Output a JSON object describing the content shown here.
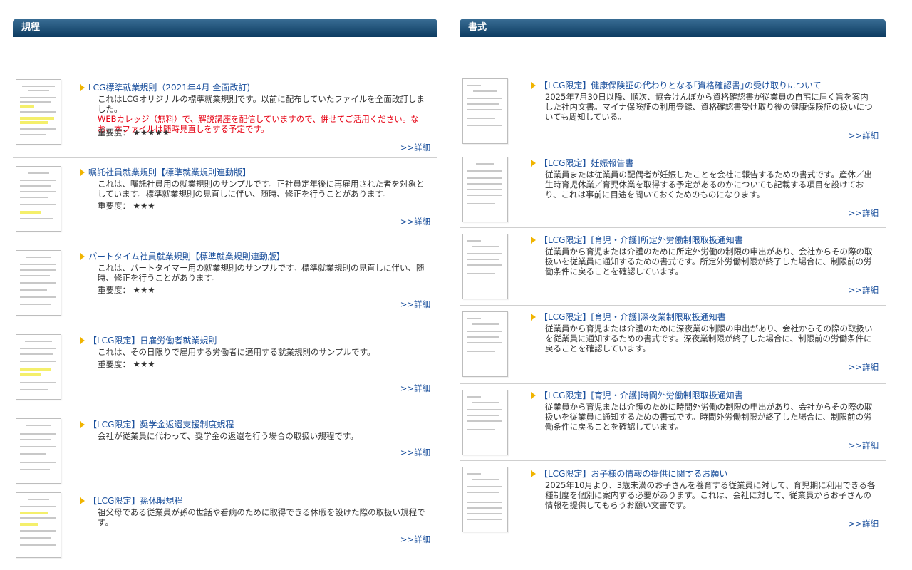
{
  "left": {
    "header": "規程",
    "importance_label": "重要度：",
    "detail_label": ">>詳細",
    "entries": [
      {
        "title": "LCG標準就業規則（2021年4月 全面改訂)",
        "desc": "これはLCGオリジナルの標準就業規則です。以前に配布していたファイルを全面改訂しました。",
        "desc_red": "WEBカレッジ（無料）で、解説講座を配信していますので、併せてご活用ください。なお、本ファイルは随時見直しをする予定です。",
        "stars": "★★★★★"
      },
      {
        "title": "嘱託社員就業規則【標準就業規則連動版】",
        "desc": "これは、嘱託社員用の就業規則のサンプルです。正社員定年後に再雇用された者を対象としています。標準就業規則の見直しに伴い、随時、修正を行うことがあります。",
        "stars": "★★★"
      },
      {
        "title": "パートタイム社員就業規則【標準就業規則連動版】",
        "desc": "これは、パートタイマー用の就業規則のサンプルです。標準就業規則の見直しに伴い、随時、修正を行うことがあります。",
        "stars": "★★★"
      },
      {
        "title": "【LCG限定】日雇労働者就業規則",
        "desc": "これは、その日限りで雇用する労働者に適用する就業規則のサンプルです。",
        "stars": "★★★"
      },
      {
        "title": "【LCG限定】奨学金返還支援制度規程",
        "desc": "会社が従業員に代わって、奨学金の返還を行う場合の取扱い規程です。"
      },
      {
        "title": "【LCG限定】孫休暇規程",
        "desc": "祖父母である従業員が孫の世話や看病のために取得できる休暇を設けた際の取扱い規程です。"
      }
    ]
  },
  "right": {
    "header": "書式",
    "detail_label": ">>詳細",
    "entries": [
      {
        "title": "【LCG限定】健康保険証の代わりとなる｢資格確認書｣の受け取りについて",
        "desc": "2025年7月30日以降、順次、協会けんぽから資格確認書が従業員の自宅に届く旨を案内した社内文書。マイナ保険証の利用登録、資格確認書受け取り後の健康保険証の扱いについても周知している。"
      },
      {
        "title": "【LCG限定】妊娠報告書",
        "desc": "従業員または従業員の配偶者が妊娠したことを会社に報告するための書式です。産休／出生時育児休業／育児休業を取得する予定があるのかについても記載する項目を設けており、これは事前に目途を聞いておくためのものになります。"
      },
      {
        "title": "【LCG限定】[育児・介護]所定外労働制限取扱通知書",
        "desc": "従業員から育児または介護のために所定外労働の制限の申出があり、会社からその際の取扱いを従業員に通知するための書式です。所定外労働制限が終了した場合に、制限前の労働条件に戻ることを確認しています。"
      },
      {
        "title": "【LCG限定】[育児・介護]深夜業制限取扱通知書",
        "desc": "従業員から育児または介護のために深夜業の制限の申出があり、会社からその際の取扱いを従業員に通知するための書式です。深夜業制限が終了した場合に、制限前の労働条件に戻ることを確認しています。"
      },
      {
        "title": "【LCG限定】[育児・介護]時間外労働制限取扱通知書",
        "desc": "従業員から育児または介護のために時間外労働の制限の申出があり、会社からその際の取扱いを従業員に通知するための書式です。時間外労働制限が終了した場合に、制限前の労働条件に戻ることを確認しています。"
      },
      {
        "title": "【LCG限定】お子様の情報の提供に関するお願い",
        "desc": "2025年10月より、3歳未満のお子さんを養育する従業員に対して、育児期に利用できる各種制度を個別に案内する必要があります。これは、会社に対して、従業員からお子さんの情報を提供してもらうお願い文書です。"
      }
    ]
  }
}
